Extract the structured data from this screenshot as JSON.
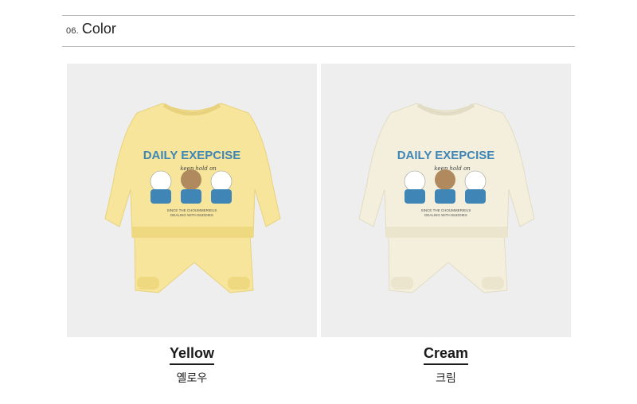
{
  "section": {
    "number": "06.",
    "title": "Color"
  },
  "products": [
    {
      "name_en": "Yellow",
      "name_ko": "옐로우",
      "graphic_title": "DAILY EXEPCISE",
      "graphic_sub": "keep hold on",
      "graphic_small_1": "SINCE THE CHOUMMERIEUS",
      "graphic_small_2": "DEALING WITH BUDDIES",
      "garment_color": "#f6e59a",
      "garment_shade": "#e8d27d"
    },
    {
      "name_en": "Cream",
      "name_ko": "크림",
      "graphic_title": "DAILY EXEPCISE",
      "graphic_sub": "keep hold on",
      "graphic_small_1": "SINCE THE CHOUMMERIEUS",
      "graphic_small_2": "DEALING WITH BUDDIES",
      "garment_color": "#f3efdc",
      "garment_shade": "#e2dcc4"
    }
  ],
  "colors": {
    "accent_blue": "#3f86b6",
    "bear_brown": "#b08a5e",
    "background": "#eeeeee"
  }
}
